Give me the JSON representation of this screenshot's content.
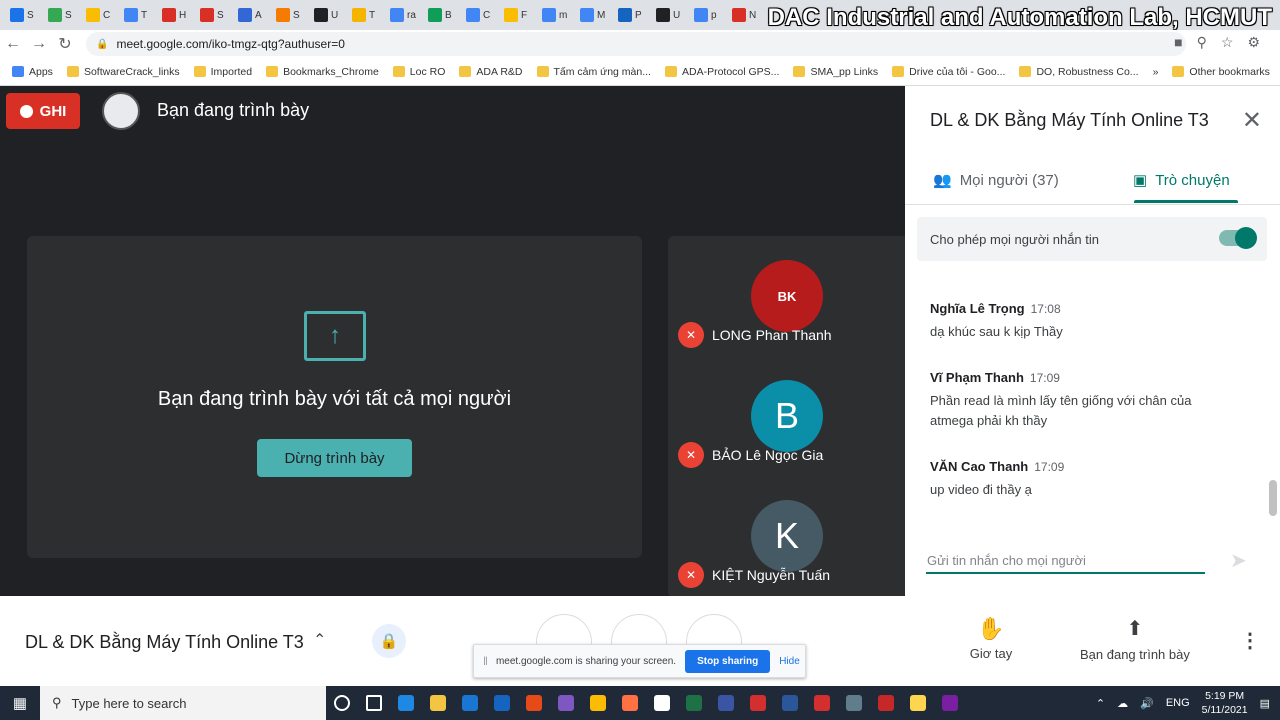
{
  "browser": {
    "tabs": [
      {
        "letter": "S",
        "color": "#1a73e8"
      },
      {
        "letter": "S",
        "color": "#34a853"
      },
      {
        "letter": "C",
        "color": "#fbbc04"
      },
      {
        "letter": "T",
        "color": "#4285f4"
      },
      {
        "letter": "H",
        "color": "#d93025"
      },
      {
        "letter": "S",
        "color": "#d93025"
      },
      {
        "letter": "A",
        "color": "#3367d6"
      },
      {
        "letter": "S",
        "color": "#f57c00"
      },
      {
        "letter": "U",
        "color": "#202124"
      },
      {
        "letter": "T",
        "color": "#f4b400"
      },
      {
        "letter": "ra",
        "color": "#4285f4"
      },
      {
        "letter": "B",
        "color": "#0f9d58"
      },
      {
        "letter": "C",
        "color": "#4285f4"
      },
      {
        "letter": "F",
        "color": "#fbbc04"
      },
      {
        "letter": "m",
        "color": "#4285f4"
      },
      {
        "letter": "M",
        "color": "#4285f4"
      },
      {
        "letter": "P",
        "color": "#1565c0"
      },
      {
        "letter": "U",
        "color": "#202124"
      },
      {
        "letter": "p",
        "color": "#4285f4"
      },
      {
        "letter": "N",
        "color": "#d93025"
      }
    ],
    "watermark": "DAC Industrial and Automation Lab, HCMUT",
    "url": "meet.google.com/iko-tmgz-qtg?authuser=0",
    "bookmarks": [
      "Apps",
      "SoftwareCrack_links",
      "Imported",
      "Bookmarks_Chrome",
      "Loc RO",
      "ADA R&D",
      "Tấm cảm ứng màn...",
      "ADA-Protocol GPS...",
      "SMA_pp Links",
      "Drive của tôi - Goo...",
      "DO, Robustness Co..."
    ],
    "bookmarks_more": "»",
    "other_bookmarks": "Other bookmarks"
  },
  "meet": {
    "rec_label": "GHI",
    "presenting_title": "Bạn đang trình bày",
    "present_message": "Bạn đang trình bày với tất cả mọi người",
    "stop_presenting": "Dừng trình bày",
    "participants": [
      {
        "name": "LONG Phan Thanh",
        "initial": "BK",
        "avatar_color": "#b71c1c"
      },
      {
        "name": "BẢO Lê Ngọc Gia",
        "initial": "B",
        "avatar_color": "#0b8ea8"
      },
      {
        "name": "KIỆT Nguyễn Tuấn",
        "initial": "K",
        "avatar_color": "#455a64"
      }
    ]
  },
  "panel": {
    "title": "DL & DK Bằng Máy Tính Online T3",
    "tab_people": "Mọi người (37)",
    "tab_chat": "Trò chuyện",
    "allow_chat": "Cho phép mọi người nhắn tin",
    "allow_chat_on": true,
    "messages": [
      {
        "sender": "Nghĩa Lê Trọng",
        "time": "17:08",
        "text": "dạ khúc sau k kịp Thầy"
      },
      {
        "sender": "Vĩ Phạm Thanh",
        "time": "17:09",
        "text": "Phần read là mình lấy tên giống với chân của atmega phải kh thầy"
      },
      {
        "sender": "VĂN Cao Thanh",
        "time": "17:09",
        "text": "up video đi thầy ạ"
      }
    ],
    "compose_placeholder": "Gửi tin nhắn cho mọi người"
  },
  "bottom": {
    "meeting_name": "DL & DK Bằng Máy Tính Online T3",
    "raise_hand": "Giơ tay",
    "present_now": "Bạn đang trình bày"
  },
  "share_bar": {
    "text": "meet.google.com is sharing your screen.",
    "stop_label": "Stop sharing",
    "hide_label": "Hide"
  },
  "taskbar": {
    "search_placeholder": "Type here to search",
    "apps": [
      {
        "name": "task-view",
        "color": "#ffffff"
      },
      {
        "name": "widgets",
        "color": "#ffffff"
      },
      {
        "name": "edge",
        "color": "#1e88e5"
      },
      {
        "name": "file-explorer",
        "color": "#f4c542"
      },
      {
        "name": "mail",
        "color": "#1976d2"
      },
      {
        "name": "store",
        "color": "#1565c0"
      },
      {
        "name": "office",
        "color": "#e64a19"
      },
      {
        "name": "viber",
        "color": "#7e57c2"
      },
      {
        "name": "chrome",
        "color": "#fbbc04"
      },
      {
        "name": "skype",
        "color": "#ff7043"
      },
      {
        "name": "messenger",
        "color": "#ffffff"
      },
      {
        "name": "excel",
        "color": "#1e7145"
      },
      {
        "name": "visio",
        "color": "#3955a3"
      },
      {
        "name": "recorder",
        "color": "#d32f2f"
      },
      {
        "name": "word",
        "color": "#2b579a"
      },
      {
        "name": "acrobat",
        "color": "#d32f2f"
      },
      {
        "name": "app-1",
        "color": "#607d8b"
      },
      {
        "name": "cv-app",
        "color": "#c62828"
      },
      {
        "name": "app-2",
        "color": "#ffd54f"
      },
      {
        "name": "visual-studio",
        "color": "#7b1fa2"
      }
    ],
    "lang": "ENG",
    "time": "5:19 PM",
    "date": "5/11/2021"
  }
}
